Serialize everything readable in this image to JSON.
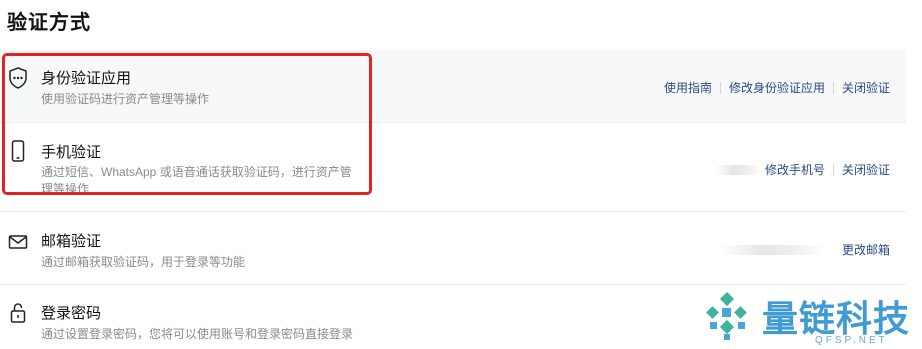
{
  "page": {
    "title": "验证方式"
  },
  "methods": [
    {
      "title": "身份验证应用",
      "desc": "使用验证码进行资产管理等操作",
      "icon": "shield-password-icon",
      "actions": [
        "使用指南",
        "修改身份验证应用",
        "关闭验证"
      ]
    },
    {
      "title": "手机验证",
      "desc": "通过短信、WhatsApp 或语音通话获取验证码，进行资产管理等操作",
      "icon": "mobile-phone-icon",
      "masked_value": "*******",
      "actions": [
        "修改手机号",
        "关闭验证"
      ]
    },
    {
      "title": "邮箱验证",
      "desc": "通过邮箱获取验证码，用于登录等功能",
      "icon": "mail-icon",
      "masked_value": "*************",
      "actions": [
        "更改邮箱"
      ]
    },
    {
      "title": "登录密码",
      "desc": "通过设置登录密码，您将可以使用账号和登录密码直接登录",
      "icon": "lock-icon",
      "actions": []
    }
  ],
  "watermark": {
    "name": "量链科技",
    "sub": "QFSP.NET",
    "icon": "logo-icon"
  },
  "colors": {
    "link": "#2b4a85",
    "highlight": "#e02424",
    "watermark": "#3f9bd4"
  }
}
